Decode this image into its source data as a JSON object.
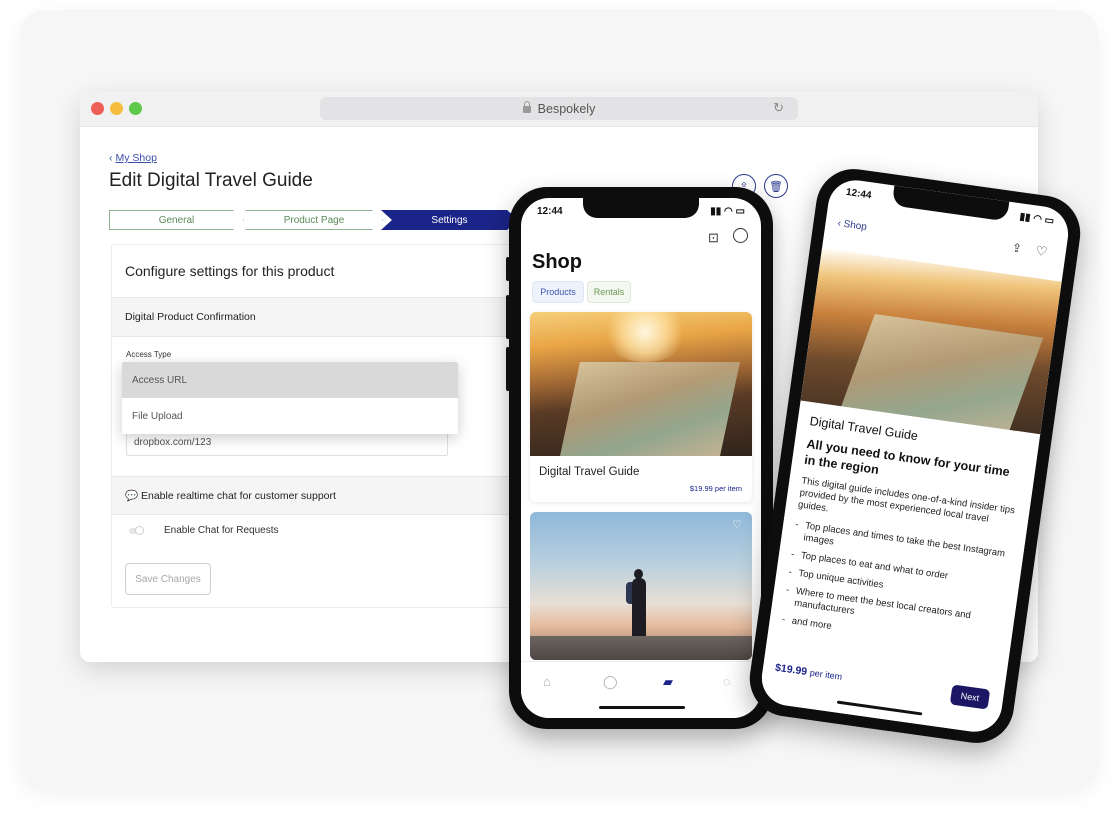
{
  "browser": {
    "url_title": "Bespokely"
  },
  "page": {
    "back_link": "My Shop",
    "title": "Edit Digital Travel Guide"
  },
  "steps": [
    {
      "label": "General",
      "active": false
    },
    {
      "label": "Product Page",
      "active": false
    },
    {
      "label": "Settings",
      "active": true
    }
  ],
  "settings": {
    "heading": "Configure settings for this product",
    "section_confirmation": "Digital Product Confirmation",
    "access_type_label": "Access Type",
    "access_options": [
      "Access URL",
      "File Upload"
    ],
    "selected_option": "Access URL",
    "url_value": "dropbox.com/123",
    "chat_section": "💬 Enable realtime chat for customer support",
    "chat_toggle_label": "Enable Chat for Requests",
    "save_label": "Save Changes",
    "help_label": "?"
  },
  "colors": {
    "accent": "#1b2488",
    "step_border": "#8fb48f",
    "link": "#3b4ea8"
  },
  "phone_shop": {
    "time": "12:44",
    "title": "Shop",
    "tabs": [
      "Products",
      "Rentals"
    ],
    "product": {
      "name": "Digital Travel Guide",
      "price": "$19.99",
      "unit": "per item"
    }
  },
  "phone_detail": {
    "time": "12:44",
    "back_label": "Shop",
    "title": "Digital Travel Guide",
    "headline": "All you need to know for your time in the region",
    "description": "This digital guide includes one-of-a-kind insider tips provided by the most experienced local travel guides.",
    "bullets": [
      "Top places and times to take the best Instagram images",
      "Top places to eat and what to order",
      "Top unique activities",
      "Where to meet the best local creators and manufacturers",
      "and more"
    ],
    "price": "$19.99",
    "unit": "per item",
    "next_label": "Next"
  }
}
